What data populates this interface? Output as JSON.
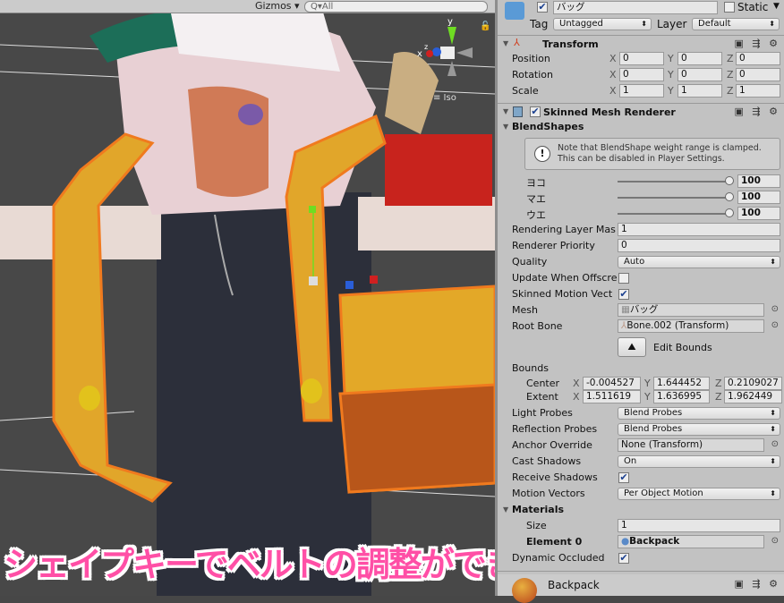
{
  "viewport": {
    "gizmos_label": "Gizmos ▾",
    "search_placeholder": "Q▾All",
    "projection_label": "≡ Iso",
    "caption": "シェイプキーでベルトの調整ができるよ！",
    "axis_labels": {
      "x": "x",
      "y": "y",
      "z": "z"
    }
  },
  "object": {
    "name": "バッグ",
    "active": true,
    "static_label": "Static",
    "static": false,
    "tag_label": "Tag",
    "tag": "Untagged",
    "layer_label": "Layer",
    "layer": "Default"
  },
  "transform": {
    "title": "Transform",
    "rows": [
      {
        "label": "Position",
        "x": "0",
        "y": "0",
        "z": "0"
      },
      {
        "label": "Rotation",
        "x": "0",
        "y": "0",
        "z": "0"
      },
      {
        "label": "Scale",
        "x": "1",
        "y": "1",
        "z": "1"
      }
    ]
  },
  "smr": {
    "title": "Skinned Mesh Renderer",
    "enabled": true,
    "blendshapes_label": "BlendShapes",
    "help": "Note that BlendShape weight range is clamped.\nThis can be disabled in Player Settings.",
    "shapes": [
      {
        "label": "ヨコ",
        "value": "100"
      },
      {
        "label": "マエ",
        "value": "100"
      },
      {
        "label": "ウエ",
        "value": "100"
      }
    ],
    "rendering_layer_mask": {
      "label": "Rendering Layer Mas",
      "value": "1"
    },
    "renderer_priority": {
      "label": "Renderer Priority",
      "value": "0"
    },
    "quality": {
      "label": "Quality",
      "value": "Auto"
    },
    "update_offscreen": {
      "label": "Update When Offscre",
      "checked": false
    },
    "skinned_motion": {
      "label": "Skinned Motion Vect",
      "checked": true
    },
    "mesh": {
      "label": "Mesh",
      "value": "バッグ"
    },
    "root_bone": {
      "label": "Root Bone",
      "value": "Bone.002 (Transform)"
    },
    "edit_bounds": "Edit Bounds",
    "bounds": {
      "label": "Bounds",
      "center_label": "Center",
      "extent_label": "Extent",
      "center": {
        "x": "-0.004527",
        "y": "1.644452",
        "z": "0.2109027"
      },
      "extent": {
        "x": "1.511619",
        "y": "1.636995",
        "z": "1.962449"
      }
    },
    "light_probes": {
      "label": "Light Probes",
      "value": "Blend Probes"
    },
    "reflection_probes": {
      "label": "Reflection Probes",
      "value": "Blend Probes"
    },
    "anchor_override": {
      "label": "Anchor Override",
      "value": "None (Transform)"
    },
    "cast_shadows": {
      "label": "Cast Shadows",
      "value": "On"
    },
    "receive_shadows": {
      "label": "Receive Shadows",
      "checked": true
    },
    "motion_vectors": {
      "label": "Motion Vectors",
      "value": "Per Object Motion"
    },
    "materials": {
      "label": "Materials",
      "size_label": "Size",
      "size": "1",
      "element_label": "Element 0",
      "element": "Backpack"
    },
    "dynamic_occluded": {
      "label": "Dynamic Occluded",
      "checked": true
    }
  },
  "material_header": {
    "name": "Backpack"
  },
  "colors": {
    "inspector_bg": "#c2c2c2",
    "viewport_bg": "#484848",
    "caption": "#ff4fa6",
    "selection_outline": "#f07a1e"
  }
}
